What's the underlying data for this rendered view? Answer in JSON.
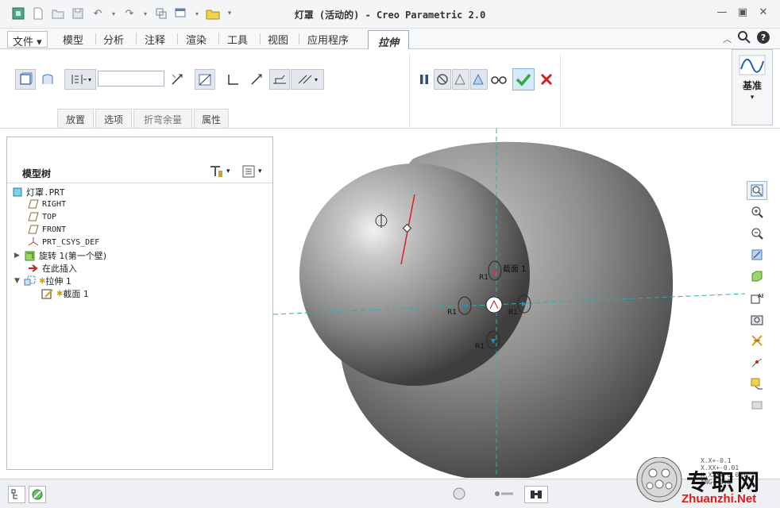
{
  "window": {
    "title": "灯罩 (活动的) - Creo Parametric 2.0"
  },
  "menu": {
    "tabs": [
      "文件",
      "模型",
      "分析",
      "注释",
      "渲染",
      "工具",
      "视图",
      "应用程序",
      "拉伸"
    ],
    "active_tab": "拉伸"
  },
  "ribbon": {
    "depth_value": "",
    "slideups": [
      "放置",
      "选项",
      "折弯余量",
      "属性"
    ],
    "datum_label": "基准"
  },
  "model_tree": {
    "header": "模型树",
    "items": [
      {
        "label": "灯罩.PRT",
        "icon": "part-icon"
      },
      {
        "label": "RIGHT",
        "icon": "datum-plane-icon"
      },
      {
        "label": "TOP",
        "icon": "datum-plane-icon"
      },
      {
        "label": "FRONT",
        "icon": "datum-plane-icon"
      },
      {
        "label": "PRT_CSYS_DEF",
        "icon": "csys-icon"
      },
      {
        "label": "旋转 1(第一个壁)",
        "icon": "revolve-icon"
      },
      {
        "label": "在此插入",
        "icon": "insert-arrow-icon"
      },
      {
        "label": "拉伸 1",
        "icon": "extrude-icon"
      },
      {
        "label": "截面 1",
        "icon": "sketch-icon"
      }
    ]
  },
  "viewport": {
    "section_label": "截面 1",
    "handle_labels": [
      "R1",
      "R1",
      "R1",
      "R1"
    ]
  },
  "watermark": {
    "brand_cn": "专职网",
    "brand_url": "Zhuanzhi.Net",
    "tolerances": [
      "X.X+-0.1",
      "X.XX+-0.01",
      "X.XXX+-0.001",
      "ANG+-0.5"
    ]
  },
  "colors": {
    "accent": "#2f6fd1",
    "confirm": "#2fae3a",
    "cancel": "#d22020",
    "axis": "#27b0b0"
  }
}
